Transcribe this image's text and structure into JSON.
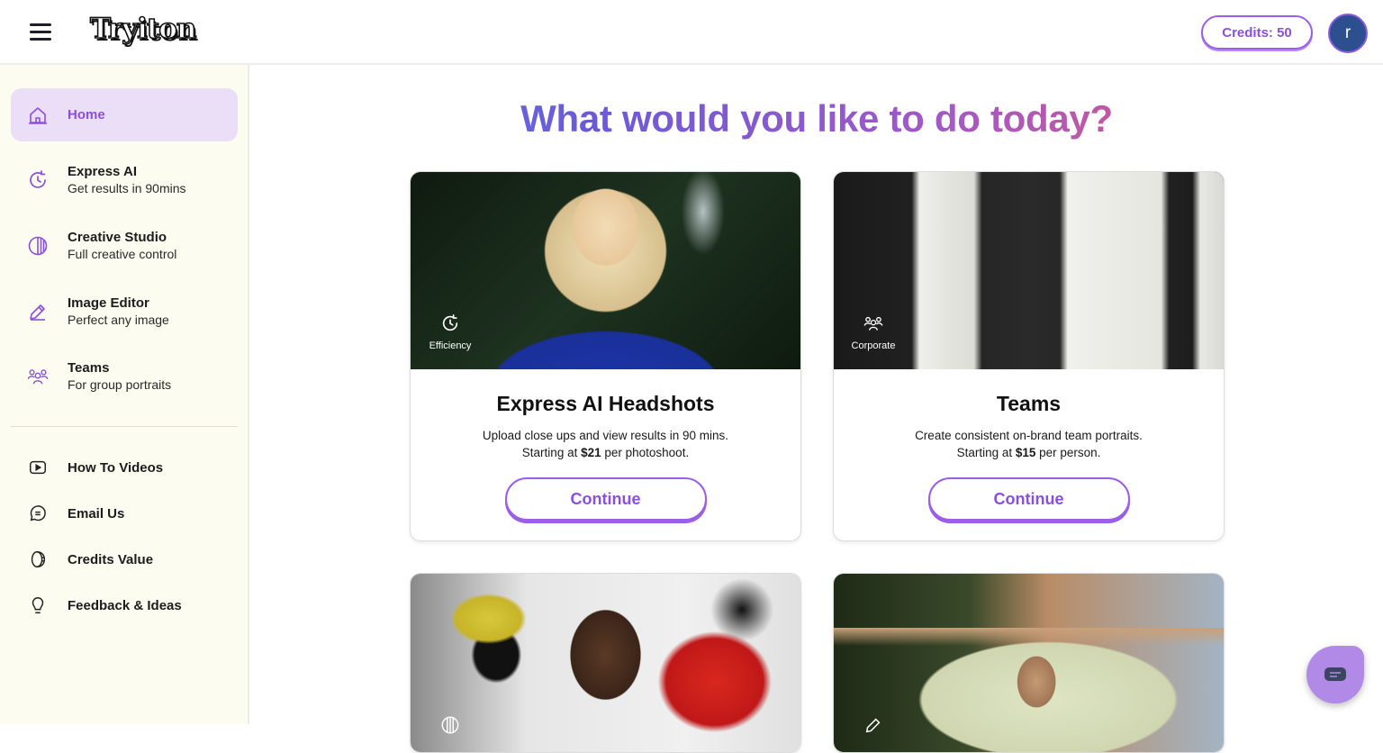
{
  "header": {
    "logo_text": "Tryiton",
    "credits_label": "Credits: 50",
    "avatar_initial": "r"
  },
  "sidebar": {
    "primary_items": [
      {
        "title": "Home",
        "subtitle": "",
        "icon": "home-icon",
        "active": true
      },
      {
        "title": "Express AI",
        "subtitle": "Get results in 90mins",
        "icon": "clock-refresh-icon",
        "active": false
      },
      {
        "title": "Creative Studio",
        "subtitle": "Full creative control",
        "icon": "circle-stripes-icon",
        "active": false
      },
      {
        "title": "Image Editor",
        "subtitle": "Perfect any image",
        "icon": "pencil-icon",
        "active": false
      },
      {
        "title": "Teams",
        "subtitle": "For group portraits",
        "icon": "group-icon",
        "active": false
      }
    ],
    "secondary_items": [
      {
        "title": "How To Videos",
        "icon": "video-play-icon"
      },
      {
        "title": "Email Us",
        "icon": "chat-bubble-icon"
      },
      {
        "title": "Credits Value",
        "icon": "coin-icon"
      },
      {
        "title": "Feedback & Ideas",
        "icon": "lightbulb-icon"
      }
    ]
  },
  "main": {
    "title": "What would you like to do today?",
    "cards": [
      {
        "badge_label": "Efficiency",
        "badge_icon": "clock-refresh-icon",
        "title": "Express AI Headshots",
        "desc_line1": "Upload close ups and view results in 90 mins.",
        "desc_prefix": "Starting at ",
        "price": "$21",
        "desc_suffix": " per photoshoot.",
        "button_label": "Continue"
      },
      {
        "badge_label": "Corporate",
        "badge_icon": "group-icon",
        "title": "Teams",
        "desc_line1": "Create consistent on-brand team portraits.",
        "desc_prefix": "Starting at ",
        "price": "$15",
        "desc_suffix": " per person.",
        "button_label": "Continue"
      }
    ]
  },
  "colors": {
    "accent": "#8b4fe0",
    "active_nav_bg": "#ebdff7",
    "sidebar_bg": "#fdfcf0",
    "avatar_bg": "#2e4f8f",
    "chat_fab": "#b18ae8"
  }
}
